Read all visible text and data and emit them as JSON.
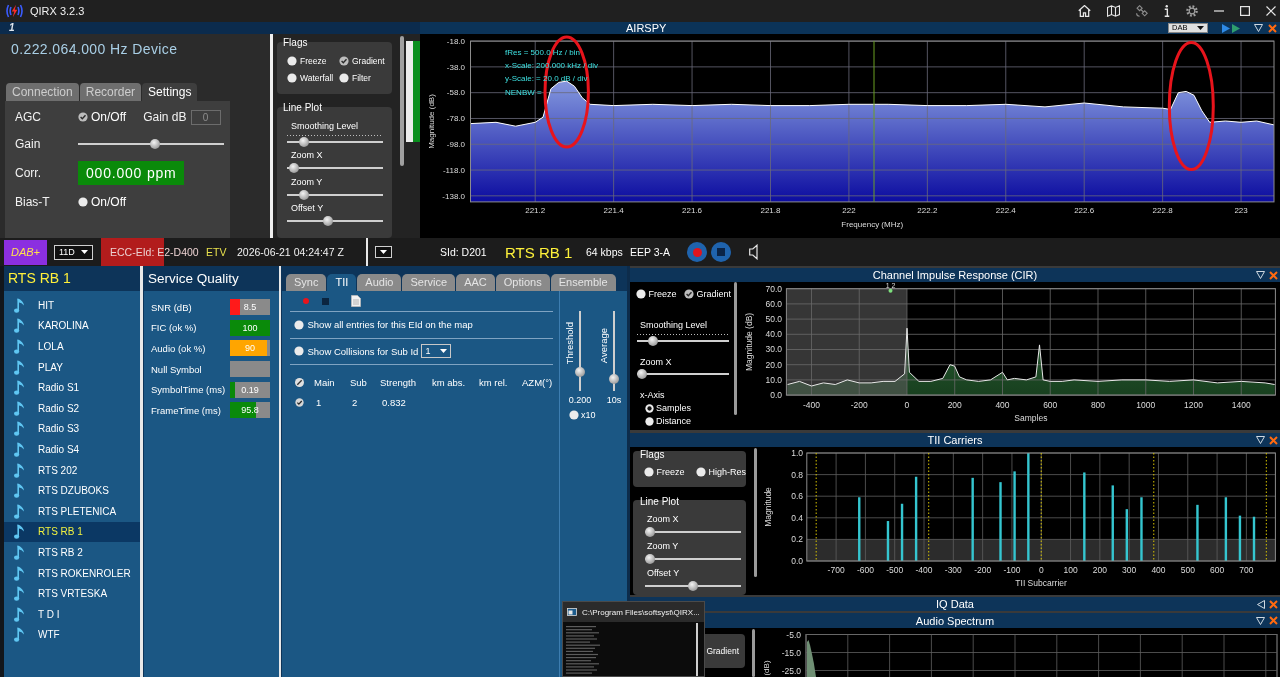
{
  "window": {
    "title": "QIRX 3.2.3"
  },
  "toolbar": {
    "label": "1"
  },
  "device": {
    "frequency": "0.222.064.000 Hz Device",
    "tabs": [
      {
        "label": "Connection",
        "selected": false
      },
      {
        "label": "Recorder",
        "selected": false
      },
      {
        "label": "Settings",
        "selected": true
      }
    ],
    "settings": {
      "agc": {
        "label": "AGC",
        "option": "On/Off",
        "checked": true
      },
      "gain_db": {
        "label": "Gain dB",
        "value": "0",
        "disabled": true
      },
      "gain": {
        "label": "Gain",
        "level": 0.53
      },
      "correction": {
        "label": "Corr.",
        "value": "000.000 ppm"
      },
      "bias_t": {
        "label": "Bias-T",
        "option": "On/Off",
        "checked": false
      }
    }
  },
  "spectrum_controls": {
    "flags": {
      "title": "Flags",
      "options": [
        {
          "label": "Freeze",
          "checked": false
        },
        {
          "label": "Gradient",
          "checked": true
        },
        {
          "label": "Waterfall",
          "checked": false
        },
        {
          "label": "Filter",
          "checked": false
        }
      ]
    },
    "line_plot": {
      "title": "Line Plot",
      "sliders": [
        {
          "label": "Smoothing Level",
          "level": 0.14,
          "ticks": true
        },
        {
          "label": "Zoom X",
          "level": 0.02,
          "ticks": false
        },
        {
          "label": "Zoom Y",
          "level": 0.14,
          "ticks": false
        },
        {
          "label": "Offset Y",
          "level": 0.42,
          "ticks": false
        }
      ]
    }
  },
  "level_meter": {
    "level": 1
  },
  "spectrum": {
    "title": "AIRSPY",
    "mode": "DAB",
    "chart_data": [
      {
        "type": "line",
        "xlabel": "Frequency (MHz)",
        "ylabel": "Magnitude (dB)",
        "xlim": [
          221.035,
          223.084
        ],
        "ylim": [
          -142.7,
          -18
        ],
        "xticks": [
          221.2,
          221.4,
          221.6,
          221.8,
          222,
          222.2,
          222.4,
          222.6,
          222.8,
          223
        ],
        "yticks": [
          {
            "value": -18,
            "label": "-18.0"
          },
          {
            "value": -38,
            "label": "-38.0"
          },
          {
            "value": -58,
            "label": "-58.0"
          },
          {
            "value": -78,
            "label": "-78.0"
          },
          {
            "value": -98,
            "label": "-98.0"
          },
          {
            "value": -118,
            "label": "-118.0"
          },
          {
            "value": -138,
            "label": "-138.0"
          }
        ],
        "grid": true,
        "color": "#ffffff",
        "x": [
          221.035,
          221.1,
          221.15,
          221.2,
          221.22,
          221.24,
          221.26,
          221.28,
          221.3,
          221.32,
          221.34,
          221.4,
          221.5,
          221.6,
          221.7,
          221.8,
          221.9,
          222.0,
          222.1,
          222.2,
          222.3,
          222.4,
          222.5,
          222.6,
          222.7,
          222.8,
          222.82,
          222.84,
          222.86,
          222.88,
          222.9,
          222.92,
          222.96,
          223.0,
          223.04,
          223.084
        ],
        "values": [
          -82,
          -81,
          -84,
          -81,
          -77,
          -55,
          -50,
          -49,
          -53,
          -62,
          -67,
          -68,
          -67,
          -68,
          -67,
          -68,
          -68,
          -67,
          -67,
          -68,
          -68,
          -67,
          -69,
          -66,
          -69,
          -70,
          -71,
          -58,
          -57,
          -60,
          -72,
          -81,
          -80,
          -81,
          -80,
          -83
        ],
        "ref_lines": [
          {
            "axis": "x",
            "value": 222.064,
            "color": "#6aa022"
          }
        ],
        "annotations": [
          "fRes = 500.0 Hz / bin",
          "x-Scale: 200.000 kHz / div",
          "y-Scale: = 20.0 dB / div",
          "NENBW ="
        ]
      }
    ]
  },
  "status_bar": {
    "standard": "DAB+",
    "channel": "11D",
    "ensemble_id": {
      "text": "ECC-EId: E2-D400",
      "alert": true
    },
    "ensemble": "ETV",
    "timestamp": "2026-06-21 04:24:47 Z",
    "service_id": "SId: D201",
    "service": "RTS RB 1",
    "bitrate": "64 kbps",
    "protection": "EEP 3-A"
  },
  "services": {
    "title": "RTS RB 1",
    "items": [
      {
        "name": "HIT",
        "selected": false
      },
      {
        "name": "KAROLINA",
        "selected": false
      },
      {
        "name": "LOLA",
        "selected": false
      },
      {
        "name": "PLAY",
        "selected": false
      },
      {
        "name": "Radio S1",
        "selected": false
      },
      {
        "name": "Radio S2",
        "selected": false
      },
      {
        "name": "Radio S3",
        "selected": false
      },
      {
        "name": "Radio S4",
        "selected": false
      },
      {
        "name": "RTS 202",
        "selected": false
      },
      {
        "name": "RTS DZUBOKS",
        "selected": false
      },
      {
        "name": "RTS PLETENICA",
        "selected": false
      },
      {
        "name": "RTS RB 1",
        "selected": true
      },
      {
        "name": "RTS RB 2",
        "selected": false
      },
      {
        "name": "RTS ROKENROLER",
        "selected": false
      },
      {
        "name": "RTS VRTESKA",
        "selected": false
      },
      {
        "name": "T D I",
        "selected": false
      },
      {
        "name": "WTF",
        "selected": false
      }
    ]
  },
  "service_quality": {
    "title": "Service Quality",
    "rows": [
      {
        "label": "SNR (dB)",
        "value": "8.5",
        "level": 0.25,
        "color": "#ff1a1a"
      },
      {
        "label": "FIC (ok %)",
        "value": "100",
        "level": 1,
        "color": "#0a8a0a"
      },
      {
        "label": "Audio (ok %)",
        "value": "90",
        "level": 0.92,
        "color": "#ffa500"
      },
      {
        "label": "Null Symbol"
      },
      {
        "label": "SymbolTime (ms)",
        "value": "0.19",
        "level": 0.13,
        "color": "#0a8a0a"
      },
      {
        "label": "FrameTime (ms)",
        "value": "95.8",
        "level": 0.64,
        "color": "#0a8a0a"
      }
    ]
  },
  "tii": {
    "tabs": [
      {
        "label": "Sync",
        "selected": false
      },
      {
        "label": "TII",
        "selected": true
      },
      {
        "label": "Audio",
        "selected": false
      },
      {
        "label": "Service",
        "selected": false
      },
      {
        "label": "AAC",
        "selected": false
      },
      {
        "label": "Options",
        "selected": false
      },
      {
        "label": "Ensemble",
        "selected": false
      }
    ],
    "options": [
      {
        "label": "Show all entries for this EId on the map",
        "checked": false
      },
      {
        "label": "Show Collisions for Sub Id",
        "checked": false,
        "sub_id": "1"
      }
    ],
    "table": {
      "columns": [
        "Main",
        "Sub",
        "Strength",
        "km abs.",
        "km rel.",
        "AZM(°)"
      ],
      "rows": [
        {
          "checked": true,
          "cells": [
            "1",
            "2",
            "0.832"
          ]
        }
      ]
    },
    "threshold": {
      "label": "Threshold",
      "value": "0.200",
      "level": 0.2
    },
    "average": {
      "label": "Average",
      "value": "10s",
      "level": 0.1
    },
    "x10": {
      "label": "x10",
      "checked": false
    }
  },
  "cir": {
    "title": "Channel Impulse Response (CIR)",
    "expanded": true,
    "flags": [
      {
        "label": "Freeze",
        "checked": false
      },
      {
        "label": "Gradient",
        "checked": true
      }
    ],
    "sliders": [
      {
        "label": "Smoothing Level",
        "level": 0.13,
        "ticks": true
      },
      {
        "label": "Zoom X",
        "level": 0,
        "ticks": false
      }
    ],
    "x_axis": {
      "label": "x-Axis",
      "options": [
        {
          "label": "Samples",
          "selected": true
        },
        {
          "label": "Distance",
          "selected": false
        }
      ]
    },
    "peak_marker": {
      "label": "1 2"
    },
    "chart_data": [
      {
        "type": "area",
        "xlabel": "Samples",
        "ylabel": "Magnitude (dB)",
        "xlim": [
          -505,
          1543
        ],
        "ylim": [
          0,
          70
        ],
        "xticks": [
          -400,
          -200,
          0,
          200,
          400,
          600,
          800,
          1000,
          1200,
          1400
        ],
        "yticks": [
          {
            "value": 0,
            "label": "0.0"
          },
          {
            "value": 10,
            "label": "10.0"
          },
          {
            "value": 20,
            "label": "20.0"
          },
          {
            "value": 30,
            "label": "30.0"
          },
          {
            "value": 40,
            "label": "40.0"
          },
          {
            "value": 50,
            "label": "50.0"
          },
          {
            "value": 60,
            "label": "60.0"
          },
          {
            "value": 70,
            "label": "70.0"
          }
        ],
        "grid": true,
        "color": "#e8e8e8",
        "x": [
          -500,
          -450,
          -400,
          -350,
          -300,
          -250,
          -200,
          -150,
          -100,
          -50,
          -10,
          0,
          10,
          50,
          100,
          150,
          180,
          200,
          220,
          250,
          300,
          350,
          400,
          420,
          450,
          500,
          540,
          555,
          570,
          600,
          650,
          700,
          800,
          900,
          1000,
          1100,
          1200,
          1300,
          1400,
          1500,
          1540
        ],
        "values": [
          7,
          9,
          6,
          8,
          7,
          10,
          8,
          8,
          9,
          9,
          14,
          44,
          15,
          9,
          9,
          11,
          20,
          19,
          12,
          10,
          9,
          10,
          15,
          10,
          11,
          10,
          12,
          33,
          10,
          9,
          9,
          10,
          9,
          10,
          10,
          9,
          10,
          8,
          9,
          8,
          7
        ],
        "bands": [
          {
            "axis": "x",
            "from": -505,
            "to": 0,
            "color": "#5a5a5a"
          }
        ]
      }
    ]
  },
  "tii_carriers": {
    "title": "TII Carriers",
    "expanded": true,
    "flags": {
      "title": "Flags",
      "options": [
        {
          "label": "Freeze",
          "checked": false
        },
        {
          "label": "High-Res",
          "checked": false
        }
      ]
    },
    "line_plot": {
      "title": "Line Plot",
      "sliders": [
        {
          "label": "Zoom X",
          "level": 0
        },
        {
          "label": "Zoom Y",
          "level": 0
        },
        {
          "label": "Offset Y",
          "level": 0.5
        }
      ]
    },
    "chart_data": [
      {
        "type": "bar",
        "xlabel": "TII Subcarrier",
        "ylabel": "Magnitude",
        "xlim": [
          -800,
          799
        ],
        "ylim": [
          0,
          1
        ],
        "xticks": [
          -700,
          -600,
          -500,
          -400,
          -300,
          -200,
          -100,
          0,
          100,
          200,
          300,
          400,
          500,
          600,
          700
        ],
        "yticks": [
          {
            "value": 0,
            "label": "0.0"
          },
          {
            "value": 0.2,
            "label": "0.2"
          },
          {
            "value": 0.4,
            "label": "0.4"
          },
          {
            "value": 0.6,
            "label": "0.6"
          },
          {
            "value": 0.8,
            "label": "0.8"
          },
          {
            "value": 1,
            "label": "1.0"
          }
        ],
        "grid": true,
        "color": "#35c6d0",
        "x": [
          -621,
          -523,
          -475,
          -427,
          -234,
          -139,
          -91,
          -44,
          147,
          244,
          292,
          342,
          533,
          630,
          678,
          726
        ],
        "values": [
          0.59,
          0.37,
          0.53,
          0.78,
          0.77,
          0.73,
          0.83,
          1.0,
          0.82,
          0.7,
          0.48,
          0.59,
          0.52,
          0.59,
          0.42,
          0.41
        ],
        "ref_lines": [
          {
            "axis": "x",
            "value": -768,
            "color": "#d8c400",
            "line_style": "dotted"
          },
          {
            "axis": "x",
            "value": -384,
            "color": "#d8c400",
            "line_style": "dotted"
          },
          {
            "axis": "x",
            "value": 0,
            "color": "#d8c400",
            "line_style": "dotted"
          },
          {
            "axis": "x",
            "value": 384,
            "color": "#d8c400",
            "line_style": "dotted"
          },
          {
            "axis": "x",
            "value": 768,
            "color": "#d8c400",
            "line_style": "dotted"
          }
        ],
        "bands": [
          {
            "axis": "y",
            "from": 0,
            "to": 0.2,
            "color": "#4a4a4a"
          }
        ]
      }
    ]
  },
  "iq_data": {
    "title": "IQ Data",
    "expanded": false
  },
  "audio_spectrum": {
    "title": "Audio Spectrum",
    "expanded": true,
    "flags": [
      {
        "label": "Gradient"
      }
    ],
    "ylabel": "(dB)",
    "y_tick_labels": [
      "-5.0",
      "-15.0",
      "-25.0"
    ]
  },
  "console": {
    "title": "C:\\Program Files\\softsyst\\QIRX..."
  }
}
